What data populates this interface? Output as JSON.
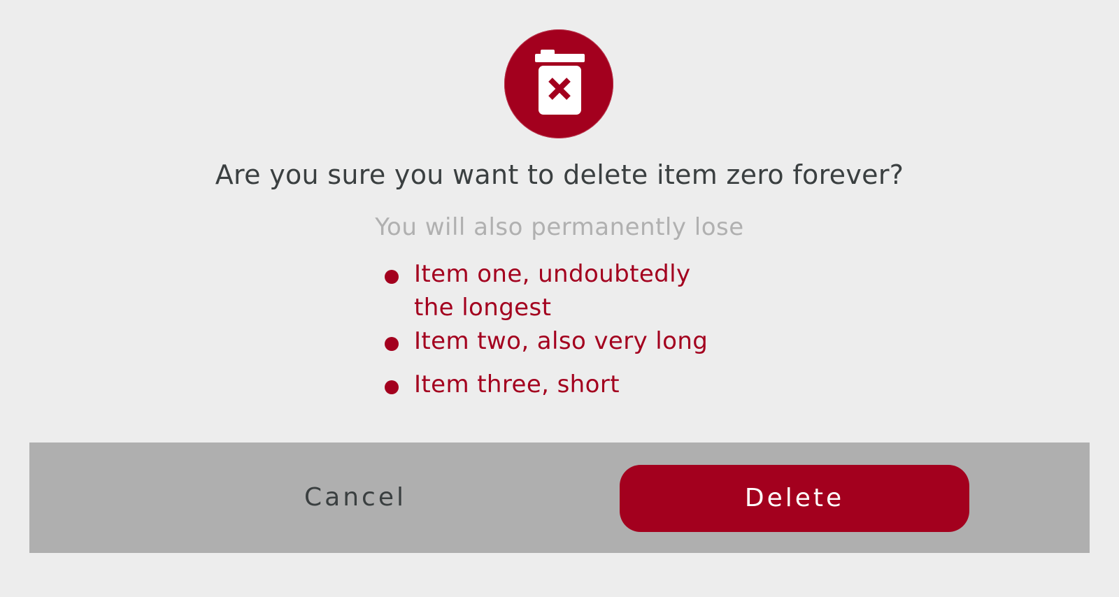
{
  "dialog": {
    "icon": "trash-delete-icon",
    "title": "Are you sure you want to delete item zero forever?",
    "subtitle": "You will also permanently lose",
    "items": [
      {
        "label": "Item one, undoubtedly the longest"
      },
      {
        "label": "Item two, also very long"
      },
      {
        "label": "Item three, short"
      }
    ],
    "actions": {
      "cancel_label": "Cancel",
      "delete_label": "Delete"
    }
  },
  "colors": {
    "accent": "#a3001e",
    "background": "#ededed",
    "footer": "#afafaf",
    "title_text": "#3a3f40",
    "subtitle_text": "#b0b0b0"
  }
}
